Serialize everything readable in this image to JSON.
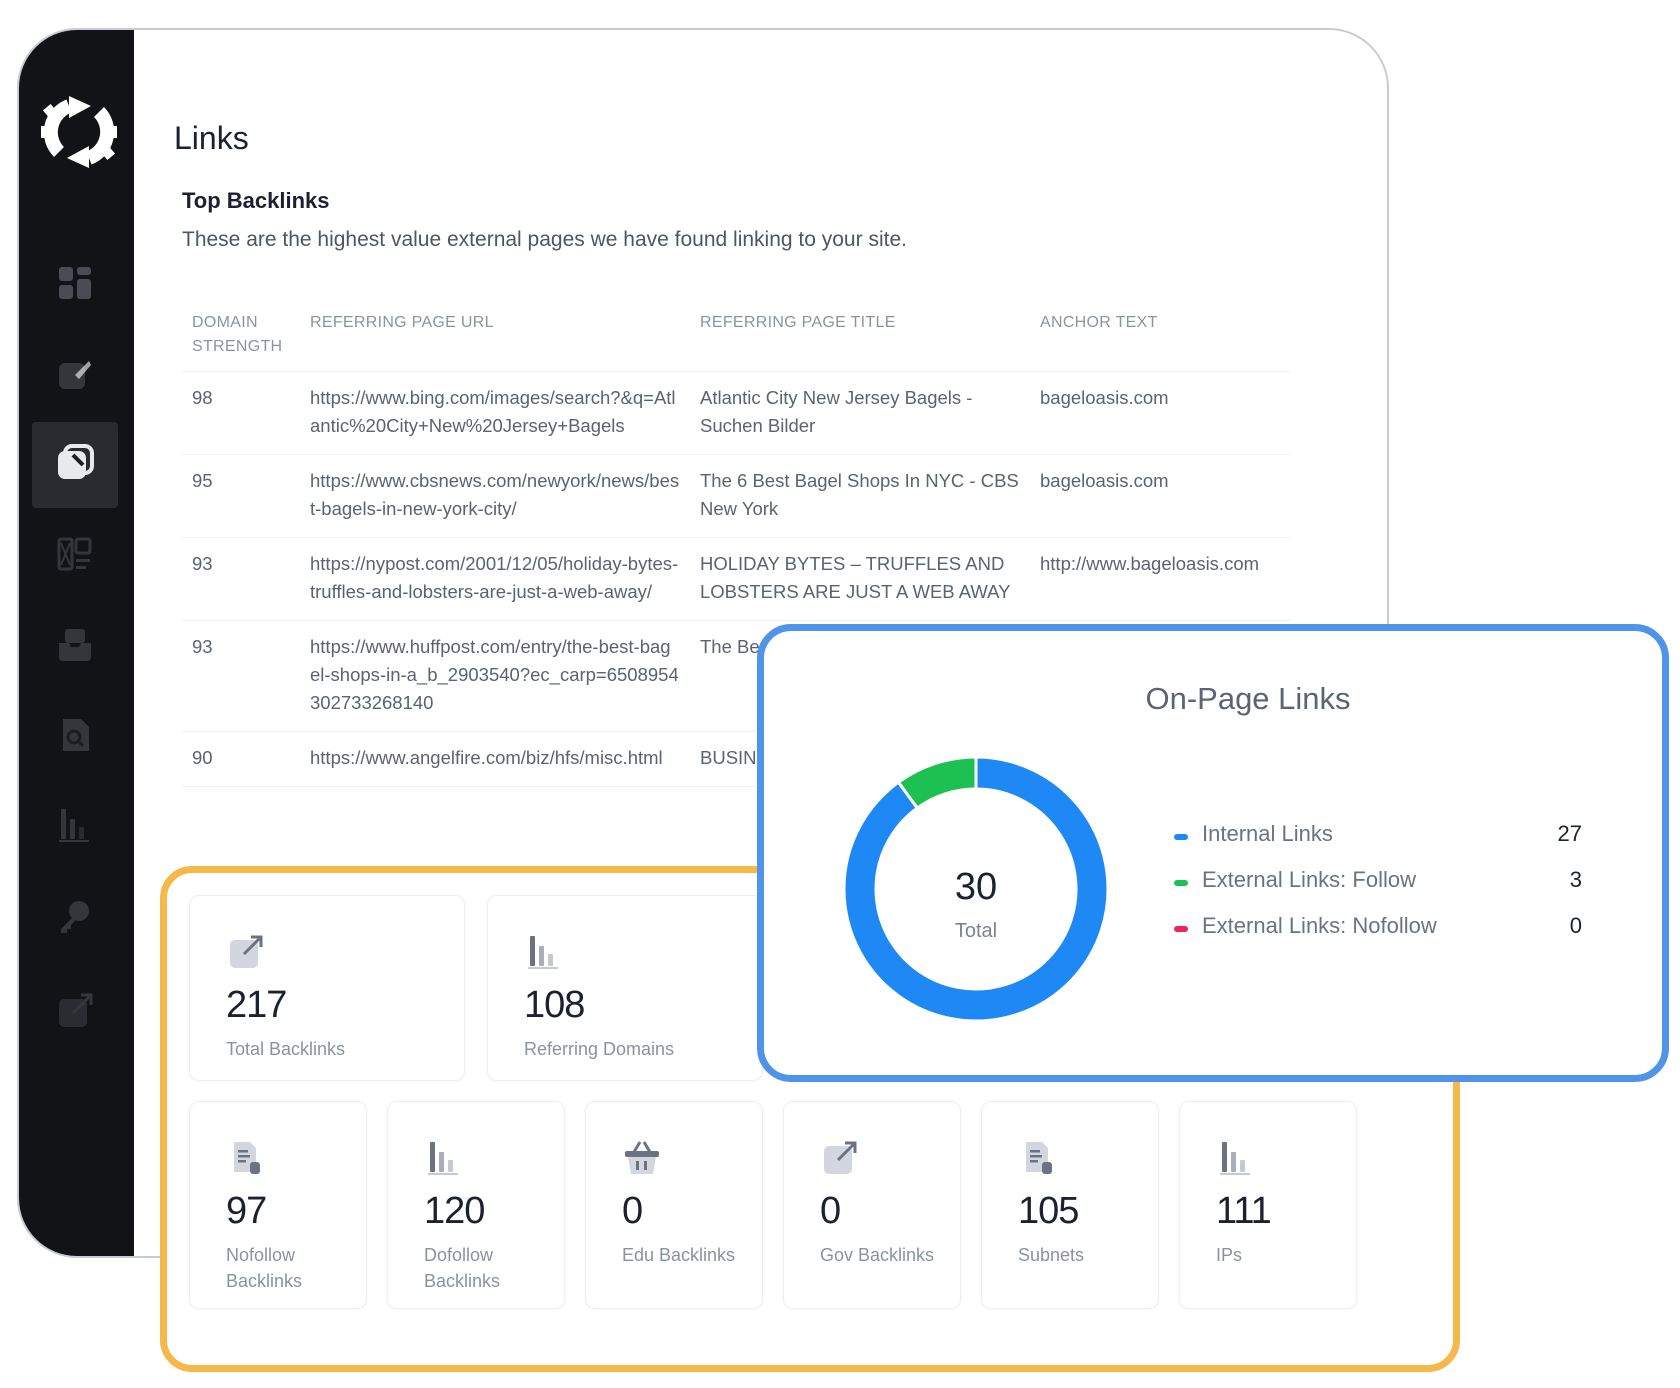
{
  "sidebar": {
    "items": [
      {
        "icon": "dashboard-icon",
        "active": false
      },
      {
        "icon": "edit-icon",
        "active": false
      },
      {
        "icon": "links-icon",
        "active": true
      },
      {
        "icon": "layout-icon",
        "active": false
      },
      {
        "icon": "inbox-icon",
        "active": false
      },
      {
        "icon": "search-document-icon",
        "active": false
      },
      {
        "icon": "bar-chart-icon",
        "active": false
      },
      {
        "icon": "key-icon",
        "active": false
      },
      {
        "icon": "external-link-icon",
        "active": false
      }
    ]
  },
  "page": {
    "title": "Links",
    "section_title": "Top Backlinks",
    "section_desc": "These are the highest value external pages we have found linking to your site."
  },
  "table": {
    "headers": [
      "DOMAIN STRENGTH",
      "REFERRING PAGE URL",
      "REFERRING PAGE TITLE",
      "ANCHOR TEXT"
    ],
    "rows": [
      {
        "ds": "98",
        "url": "https://www.bing.com/images/search?&q=Atlantic%20City+New%20Jersey+Bagels",
        "title": "Atlantic City New Jersey Bagels - Suchen Bilder",
        "anchor": "bageloasis.com"
      },
      {
        "ds": "95",
        "url": "https://www.cbsnews.com/newyork/news/best-bagels-in-new-york-city/",
        "title": "The 6 Best Bagel Shops In NYC - CBS New York",
        "anchor": "bageloasis.com"
      },
      {
        "ds": "93",
        "url": "https://nypost.com/2001/12/05/holiday-bytes-truffles-and-lobsters-are-just-a-web-away/",
        "title": "HOLIDAY BYTES – TRUFFLES AND LOBSTERS ARE JUST A WEB AWAY",
        "anchor": "http://www.bageloasis.com"
      },
      {
        "ds": "93",
        "url": "https://www.huffpost.com/entry/the-best-bagel-shops-in-a_b_2903540?ec_carp=6508954302733268140",
        "title": "The Be HuffPo",
        "anchor": ""
      },
      {
        "ds": "90",
        "url": "https://www.angelfire.com/biz/hfs/misc.html",
        "title": "BUSINE",
        "anchor": ""
      }
    ]
  },
  "stats": {
    "cards": [
      {
        "icon": "external-link-icon",
        "value": "217",
        "label": "Total Backlinks"
      },
      {
        "icon": "bar-chart-icon",
        "value": "108",
        "label": "Referring Domains"
      },
      {
        "icon": "document-icon",
        "value": "97",
        "label": "Nofollow Backlinks"
      },
      {
        "icon": "bar-chart-icon",
        "value": "120",
        "label": "Dofollow Backlinks"
      },
      {
        "icon": "basket-icon",
        "value": "0",
        "label": "Edu Backlinks"
      },
      {
        "icon": "external-link-icon",
        "value": "0",
        "label": "Gov Backlinks"
      },
      {
        "icon": "document-icon",
        "value": "105",
        "label": "Subnets"
      },
      {
        "icon": "bar-chart-icon",
        "value": "111",
        "label": "IPs"
      }
    ]
  },
  "onpage": {
    "title": "On-Page Links",
    "total_value": "30",
    "total_label": "Total",
    "legend": [
      {
        "label": "Internal Links",
        "value": "27",
        "color": "#1e88f5"
      },
      {
        "label": "External Links: Follow",
        "value": "3",
        "color": "#1dc152"
      },
      {
        "label": "External Links: Nofollow",
        "value": "0",
        "color": "#f0245a"
      }
    ]
  },
  "colors": {
    "highlight_stats": "#f5b84a",
    "highlight_onpage": "#4f94e8",
    "sidebar_bg": "#121316"
  }
}
